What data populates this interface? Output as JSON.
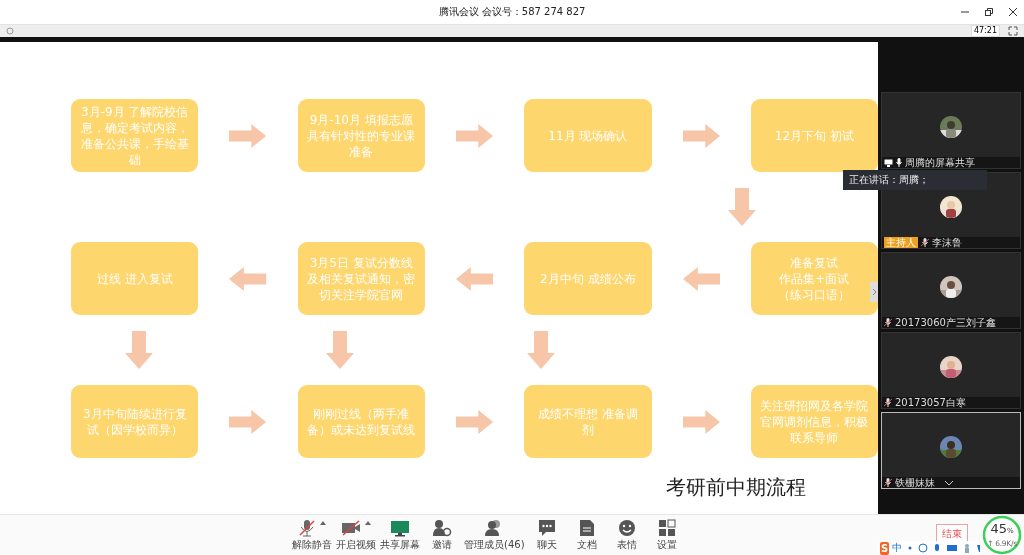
{
  "window": {
    "title": "腾讯会议 会议号：587 274 827",
    "timer": "47:21"
  },
  "slide": {
    "rows": [
      [
        "3月-9月 了解院校信息，确定考试内容，准备公共课，手绘基础",
        "9月-10月 填报志愿具有针对性的专业课准备",
        "11月 现场确认",
        "12月下旬 初试"
      ],
      [
        "过线 进入复试",
        "3月5日 复试分数线及相关复试通知，密切关注学院官网",
        "2月中旬 成绩公布",
        [
          "准备复试",
          "作品集+面试",
          "（练习口语）"
        ]
      ],
      [
        "3月中旬陆续进行复试（因学校而异）",
        "刚刚过线（两手准备）或未达到复试线",
        "成绩不理想 准备调剂",
        "关注研招网及各学院官网调剂信息，积极联系导师"
      ]
    ],
    "caption": "考研前中期流程"
  },
  "participants": [
    {
      "name": "周腾的屏幕共享",
      "host": false,
      "kind": "share"
    },
    {
      "name": "李沫鲁",
      "host": true,
      "host_label": "主持人",
      "kind": "muted"
    },
    {
      "name": "20173060产三刘子鑫",
      "host": false,
      "kind": "muted"
    },
    {
      "name": "20173057白寒",
      "host": false,
      "kind": "muted"
    },
    {
      "name": "铁栅妹妹",
      "host": false,
      "kind": "muted",
      "selected": true
    }
  ],
  "speaking": "正在讲话：周腾；",
  "toolbar": [
    {
      "label": "解除静音",
      "kind": "mic",
      "caret": true
    },
    {
      "label": "开启视频",
      "kind": "video",
      "caret": true
    },
    {
      "label": "共享屏幕",
      "kind": "share",
      "caret": false
    },
    {
      "label": "邀请",
      "kind": "invite",
      "caret": false
    },
    {
      "label": "管理成员(46)",
      "kind": "members",
      "caret": false
    },
    {
      "label": "聊天",
      "kind": "chat",
      "caret": false
    },
    {
      "label": "文档",
      "kind": "doc",
      "caret": false
    },
    {
      "label": "表情",
      "kind": "emoji",
      "caret": false
    },
    {
      "label": "设置",
      "kind": "grid",
      "caret": false
    }
  ],
  "end_button": "结束",
  "network": {
    "percent": "45",
    "unit": "%",
    "speed": "↑ 6.9K/s"
  },
  "ime": [
    "S",
    "中"
  ]
}
